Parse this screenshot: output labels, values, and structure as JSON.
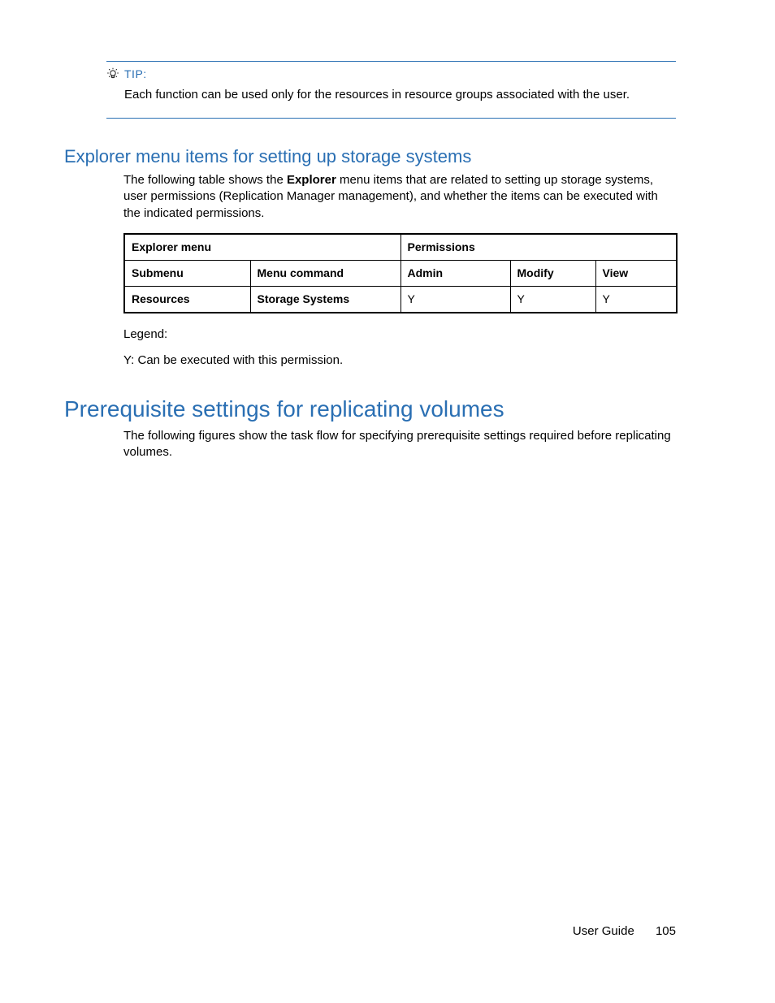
{
  "tip": {
    "label": "TIP:",
    "body": "Each function can be used only for the resources in resource groups associated with the user."
  },
  "section1": {
    "title": "Explorer menu items for setting up storage systems",
    "intro_pre": "The following table shows the ",
    "intro_bold": "Explorer",
    "intro_post": " menu items that are related to setting up storage systems, user permissions (Replication Manager management), and whether the items can be executed with the indicated permissions."
  },
  "table": {
    "head_explorer": "Explorer menu",
    "head_permissions": "Permissions",
    "sub_submenu": "Submenu",
    "sub_menucmd": "Menu command",
    "sub_admin": "Admin",
    "sub_modify": "Modify",
    "sub_view": "View",
    "row1": {
      "submenu": "Resources",
      "menucmd": "Storage Systems",
      "admin": "Y",
      "modify": "Y",
      "view": "Y"
    }
  },
  "legend": {
    "label": "Legend:",
    "line1": "Y: Can be executed with this permission."
  },
  "section2": {
    "title": "Prerequisite settings for replicating volumes",
    "intro": "The following figures show the task flow for specifying prerequisite settings required before replicating volumes."
  },
  "footer": {
    "doc": "User Guide",
    "page": "105"
  }
}
